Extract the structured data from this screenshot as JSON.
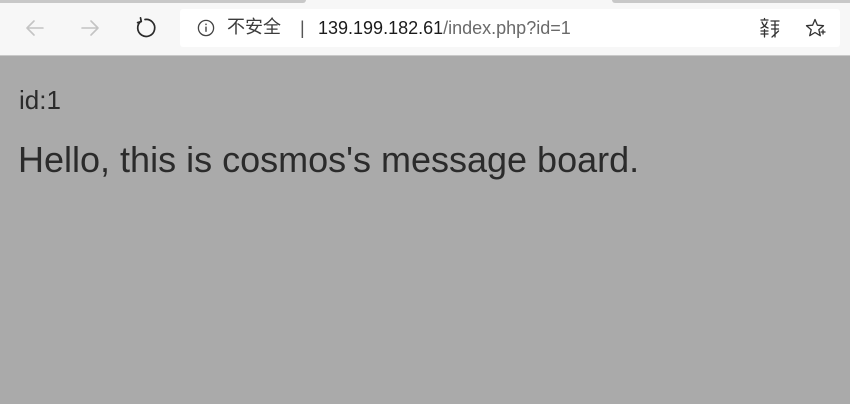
{
  "browser": {
    "nav": {
      "back_icon": "arrow-left-icon",
      "forward_icon": "arrow-right-icon",
      "refresh_icon": "refresh-icon"
    },
    "address_bar": {
      "security_icon": "info-icon",
      "security_label": "不安全",
      "separator": "|",
      "url_host": "139.199.182.61",
      "url_path": "/index.php?id=1",
      "translate_icon": "translate-icon",
      "favorite_icon": "star-icon"
    }
  },
  "page": {
    "id_line": "id:1",
    "message": "Hello, this is cosmos's message board."
  },
  "colors": {
    "page_background": "#aaaaaa",
    "toolbar_background": "#f7f7f7",
    "text": "#2b2b2b"
  }
}
